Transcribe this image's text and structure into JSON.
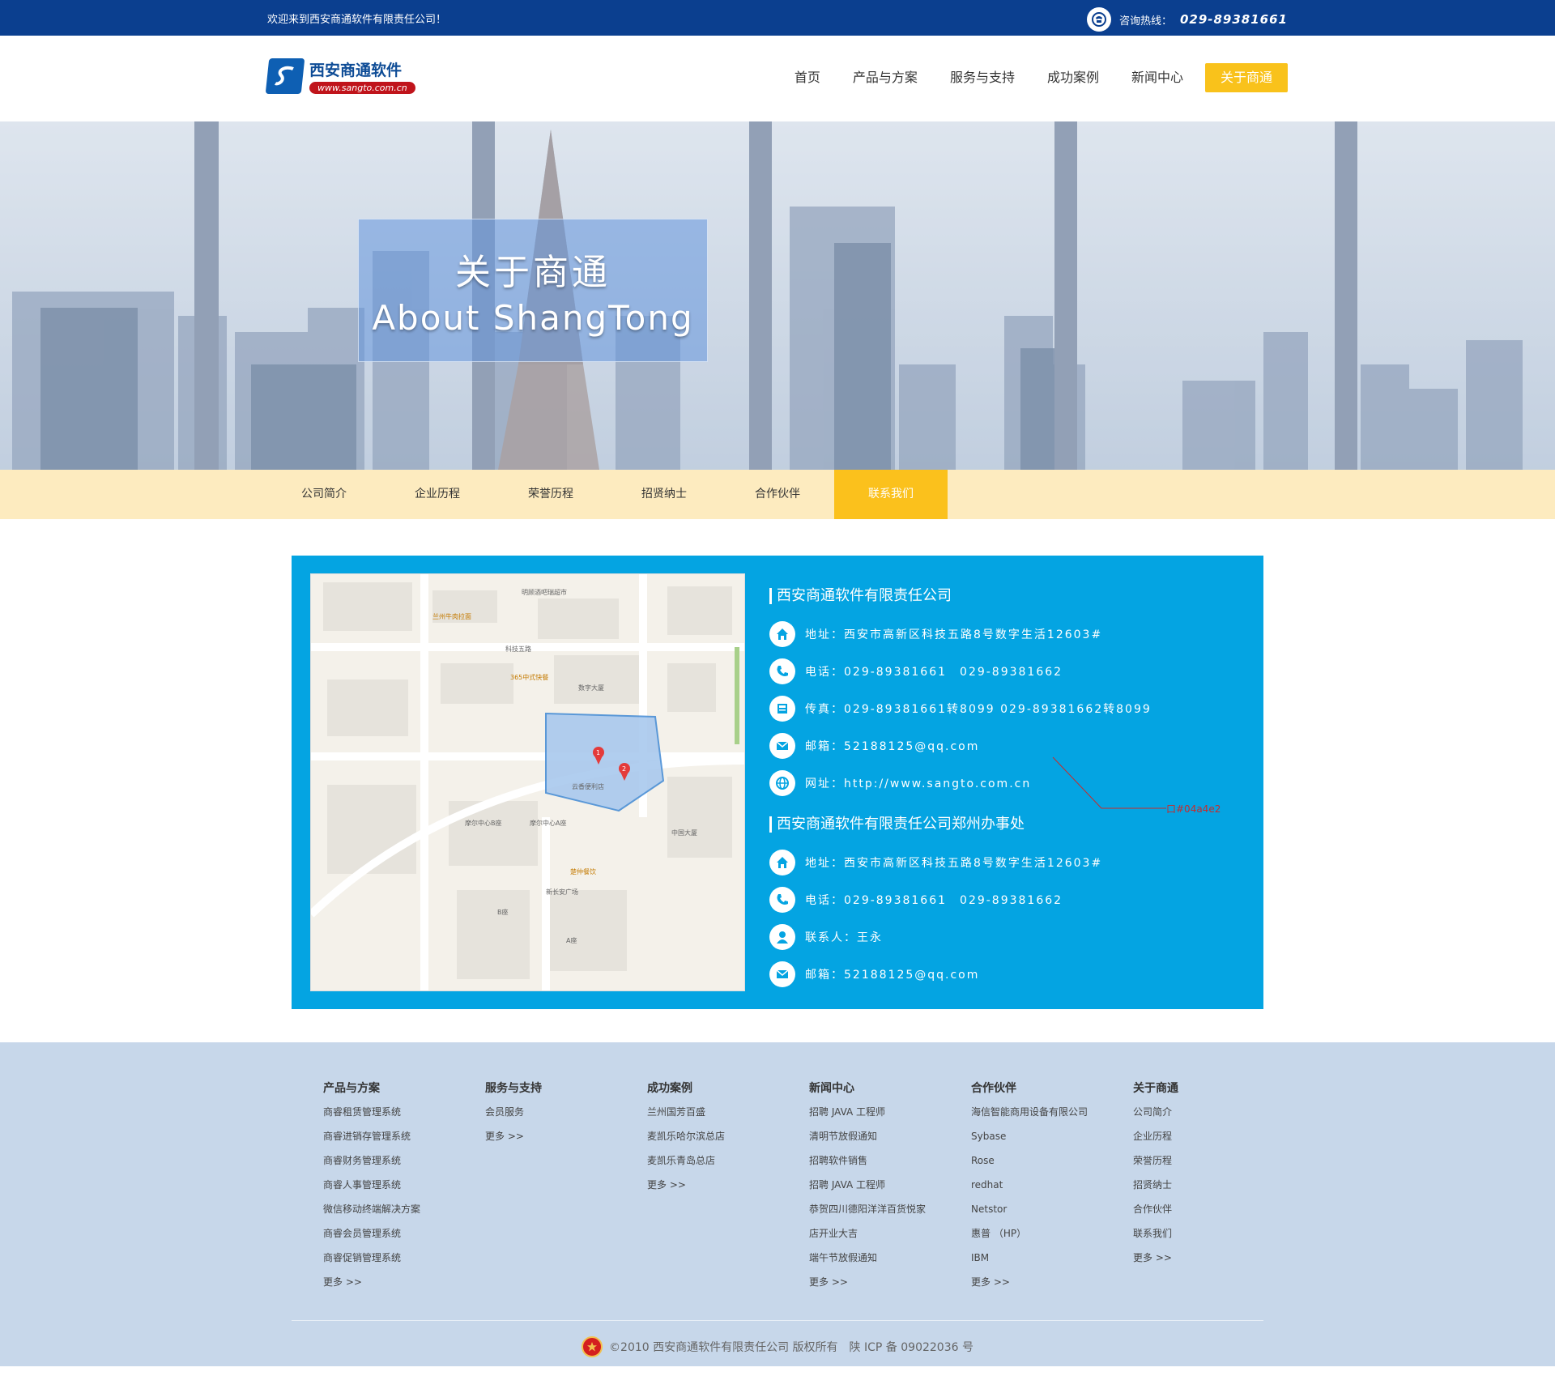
{
  "topbar": {
    "welcome": "欢迎来到西安商通软件有限责任公司！",
    "hotline_label": "咨询热线：",
    "hotline_number": "029-89381661"
  },
  "brand": {
    "name": "西安商通软件",
    "url": "www.sangto.com.cn"
  },
  "nav": {
    "items": [
      {
        "label": "首页"
      },
      {
        "label": "产品与方案"
      },
      {
        "label": "服务与支持"
      },
      {
        "label": "成功案例"
      },
      {
        "label": "新闻中心"
      },
      {
        "label": "关于商通"
      }
    ],
    "active_index": 5
  },
  "banner": {
    "title_cn": "关于商通",
    "title_en": "About ShangTong"
  },
  "subnav": {
    "items": [
      {
        "label": "公司简介"
      },
      {
        "label": "企业历程"
      },
      {
        "label": "荣誉历程"
      },
      {
        "label": "招贤纳士"
      },
      {
        "label": "合作伙伴"
      },
      {
        "label": "联系我们"
      }
    ],
    "active_index": 5
  },
  "contact": {
    "company1": "西安商通软件有限责任公司",
    "c1_address": "地址：西安市高新区科技五路8号数字生活12603#",
    "c1_phone": "电话：029-89381661　029-89381662",
    "c1_fax": "传真：029-89381661转8099 029-89381662转8099",
    "c1_email": "邮箱：52188125@qq.com",
    "c1_web": "网址：http://www.sangto.com.cn",
    "company2": "西安商通软件有限责任公司郑州办事处",
    "c2_address": "地址：西安市高新区科技五路8号数字生活12603#",
    "c2_phone": "电话：029-89381661　029-89381662",
    "c2_contact": "联系人：王永",
    "c2_email": "邮箱：52188125@qq.com",
    "annotation": "口#04a4e2"
  },
  "map": {
    "labels": [
      "科技五路",
      "数字大厦",
      "365中式快餐",
      "兰州牛肉拉面",
      "云香便利店",
      "摩尔中心A座",
      "摩尔中心B座",
      "中国大厦",
      "新长安广场",
      "楚仲餐饮",
      "A座",
      "B座",
      "明顾酒吧瑞超市"
    ]
  },
  "footer": {
    "columns": [
      {
        "title": "产品与方案",
        "links": [
          "商睿租赁管理系统",
          "商睿进销存管理系统",
          "商睿财务管理系统",
          "商睿人事管理系统",
          "微信移动终端解决方案",
          "商睿会员管理系统",
          "商睿促销管理系统",
          "更多 >>"
        ]
      },
      {
        "title": "服务与支持",
        "links": [
          "会员服务",
          "更多 >>"
        ]
      },
      {
        "title": "成功案例",
        "links": [
          "兰州国芳百盛",
          "麦凯乐哈尔滨总店",
          "麦凯乐青岛总店",
          "更多 >>"
        ]
      },
      {
        "title": "新闻中心",
        "links": [
          "招聘 JAVA 工程师",
          "清明节放假通知",
          "招聘软件销售",
          "招聘 JAVA 工程师",
          "恭贺四川德阳洋洋百货悦家",
          "店开业大吉",
          "端午节放假通知",
          "更多 >>"
        ]
      },
      {
        "title": "合作伙伴",
        "links": [
          "海信智能商用设备有限公司",
          "Sybase",
          "Rose",
          "redhat",
          "Netstor",
          "惠普 （HP）",
          "IBM",
          "更多 >>"
        ]
      },
      {
        "title": "关于商通",
        "links": [
          "公司简介",
          "企业历程",
          "荣誉历程",
          "招贤纳士",
          "合作伙伴",
          "联系我们",
          "更多 >>"
        ]
      }
    ],
    "copyright": "©2010 西安商通软件有限责任公司 版权所有　陕 ICP 备 09022036 号"
  },
  "colors": {
    "topbar": "#0b3f8f",
    "accent": "#fbc11c",
    "contact_panel": "#04a4e2",
    "footer": "#c7d7ea"
  }
}
